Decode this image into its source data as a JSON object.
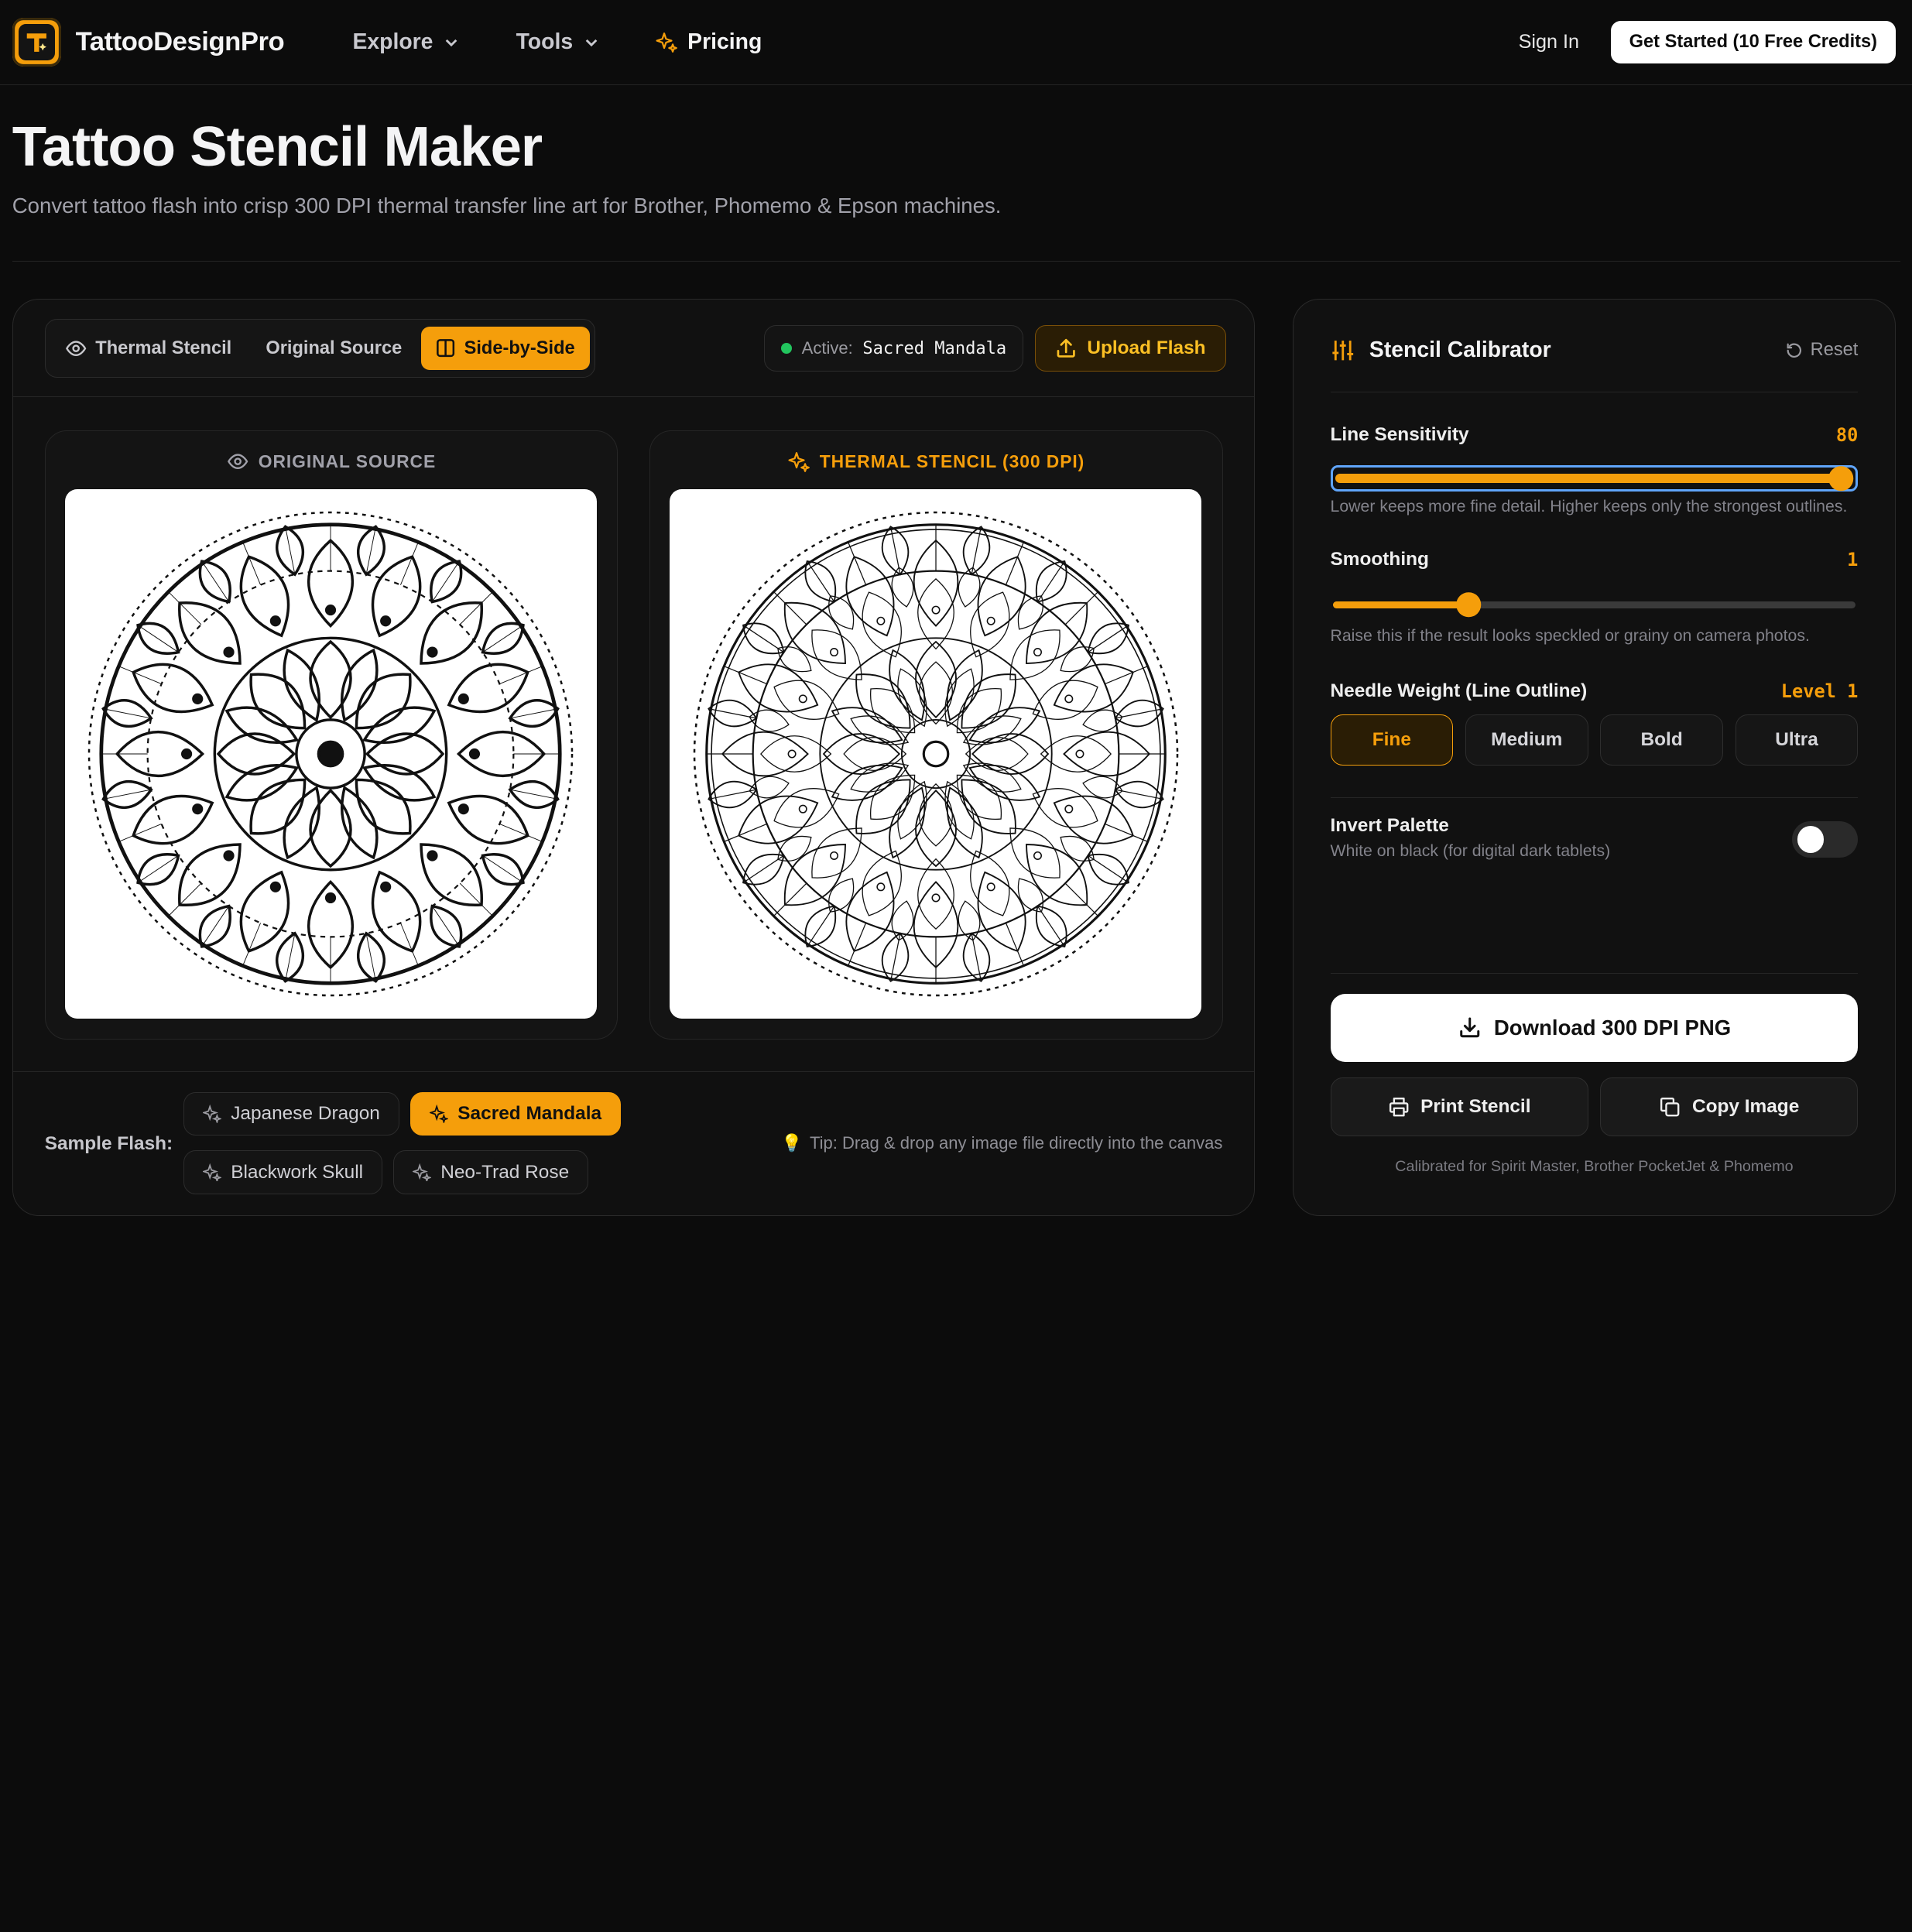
{
  "nav": {
    "brand": "TattooDesignPro",
    "links": [
      {
        "label": "Explore",
        "icon": "chevron-down-icon"
      },
      {
        "label": "Tools",
        "icon": "chevron-down-icon"
      },
      {
        "label": "Pricing",
        "icon": "sparkles-icon"
      }
    ],
    "sign_in": "Sign In",
    "cta": "Get Started (10 Free Credits)"
  },
  "hero": {
    "title": "Tattoo Stencil Maker",
    "subtitle": "Convert tattoo flash into crisp 300 DPI thermal transfer line art for Brother, Phomemo & Epson machines."
  },
  "viewer": {
    "tabs": [
      {
        "label": "Thermal Stencil",
        "icon": "eye-icon",
        "active": false
      },
      {
        "label": "Original Source",
        "active": false
      },
      {
        "label": "Side-by-Side",
        "icon": "columns-icon",
        "active": true
      }
    ],
    "active_label": "Active:",
    "active_value": "Sacred Mandala",
    "upload_label": "Upload Flash",
    "original_title": "ORIGINAL SOURCE",
    "stencil_title": "THERMAL STENCIL (300 DPI)"
  },
  "samples": {
    "label": "Sample Flash:",
    "items": [
      {
        "label": "Japanese Dragon",
        "active": false
      },
      {
        "label": "Sacred Mandala",
        "active": true
      },
      {
        "label": "Blackwork Skull",
        "active": false
      },
      {
        "label": "Neo-Trad Rose",
        "active": false
      }
    ],
    "tip": "Tip: Drag & drop any image file directly into the canvas"
  },
  "calibrator": {
    "title": "Stencil Calibrator",
    "reset": "Reset",
    "line_sensitivity": {
      "label": "Line Sensitivity",
      "value": "80",
      "fraction": 1.0,
      "hint": "Lower keeps more fine detail. Higher keeps only the strongest outlines."
    },
    "smoothing": {
      "label": "Smoothing",
      "value": "1",
      "fraction": 0.26,
      "hint": "Raise this if the result looks speckled or grainy on camera photos."
    },
    "needle": {
      "label": "Needle Weight (Line Outline)",
      "value": "Level 1",
      "options": [
        "Fine",
        "Medium",
        "Bold",
        "Ultra"
      ],
      "selected": "Fine"
    },
    "invert": {
      "label": "Invert Palette",
      "hint": "White on black (for digital dark tablets)",
      "on": false
    },
    "download": "Download 300 DPI PNG",
    "print": "Print Stencil",
    "copy": "Copy Image",
    "footnote": "Calibrated for Spirit Master, Brother PocketJet & Phomemo"
  },
  "colors": {
    "accent": "#f59e0b",
    "bg": "#0c0c0c",
    "panel": "#111111"
  }
}
